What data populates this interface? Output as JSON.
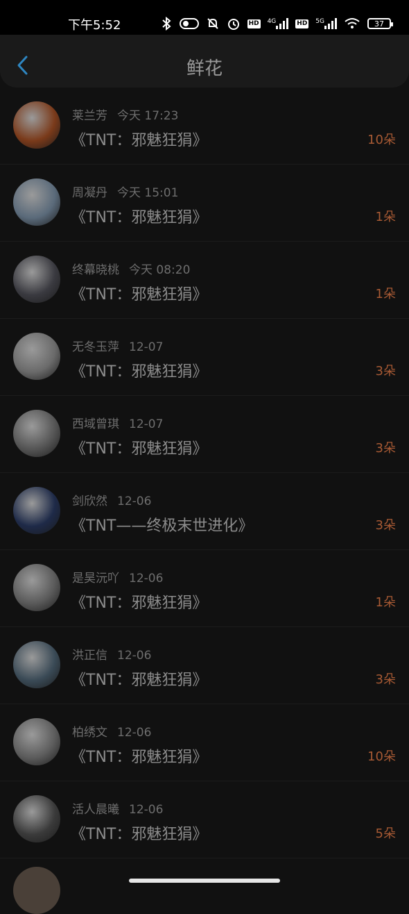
{
  "status_bar": {
    "time": "下午5:52",
    "network_4g": "4G",
    "network_5g": "5G",
    "hd": "HD",
    "battery": "37"
  },
  "header": {
    "title": "鲜花"
  },
  "items": [
    {
      "name": "莱兰芳",
      "time": "今天 17:23",
      "book": "《TNT：邪魅狂狷》",
      "count": "10朵",
      "avatar_color": "#7a3a1a"
    },
    {
      "name": "周凝丹",
      "time": "今天 15:01",
      "book": "《TNT：邪魅狂狷》",
      "count": "1朵",
      "avatar_color": "#5a6a7a"
    },
    {
      "name": "终幕晓桃",
      "time": "今天 08:20",
      "book": "《TNT：邪魅狂狷》",
      "count": "1朵",
      "avatar_color": "#3a3a40"
    },
    {
      "name": "无冬玉萍",
      "time": "12-07",
      "book": "《TNT：邪魅狂狷》",
      "count": "3朵",
      "avatar_color": "#6a6a6a"
    },
    {
      "name": "西域曾琪",
      "time": "12-07",
      "book": "《TNT：邪魅狂狷》",
      "count": "3朵",
      "avatar_color": "#555555"
    },
    {
      "name": "剑欣然",
      "time": "12-06",
      "book": "《TNT——终极末世进化》",
      "count": "3朵",
      "avatar_color": "#1e2a48"
    },
    {
      "name": "是昊沅吖",
      "time": "12-06",
      "book": "《TNT：邪魅狂狷》",
      "count": "1朵",
      "avatar_color": "#5a5a5a"
    },
    {
      "name": "洪正信",
      "time": "12-06",
      "book": "《TNT：邪魅狂狷》",
      "count": "3朵",
      "avatar_color": "#3a4a56"
    },
    {
      "name": "柏绣文",
      "time": "12-06",
      "book": "《TNT：邪魅狂狷》",
      "count": "10朵",
      "avatar_color": "#5c5c5c"
    },
    {
      "name": "活人晨曦",
      "time": "12-06",
      "book": "《TNT：邪魅狂狷》",
      "count": "5朵",
      "avatar_color": "#3a3a3a"
    }
  ],
  "colors": {
    "background": "#111111",
    "count_accent": "#a85a34",
    "back_arrow": "#2e86c1"
  }
}
